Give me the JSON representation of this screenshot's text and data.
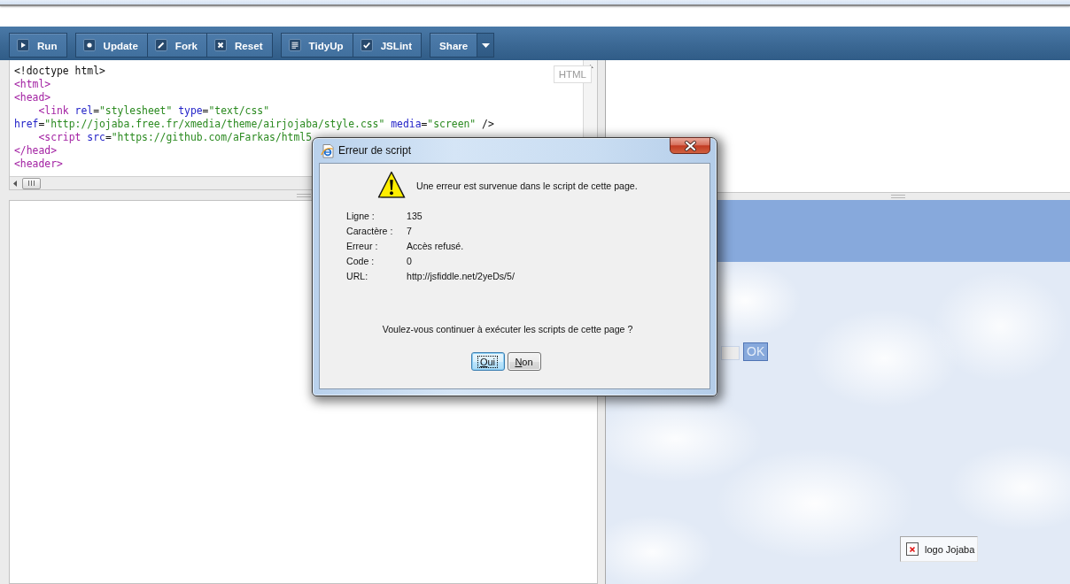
{
  "toolbar": {
    "groups": [
      {
        "buttons": [
          {
            "label": "Run",
            "kind": "action"
          }
        ]
      },
      {
        "buttons": [
          {
            "label": "Update",
            "kind": "action"
          },
          {
            "label": "Fork",
            "kind": "action"
          },
          {
            "label": "Reset",
            "kind": "action"
          }
        ]
      },
      {
        "buttons": [
          {
            "label": "TidyUp",
            "kind": "action"
          },
          {
            "label": "JSLint",
            "kind": "action"
          }
        ]
      },
      {
        "buttons": [
          {
            "label": "Share",
            "kind": "menu"
          }
        ]
      }
    ]
  },
  "html_editor": {
    "mode_label": "HTML",
    "lines": [
      {
        "tokens": [
          {
            "text": "<!doctype html>",
            "kind": "plain"
          }
        ]
      },
      {
        "tokens": [
          {
            "text": "<html>",
            "kind": "tag"
          }
        ]
      },
      {
        "tokens": [
          {
            "text": "<head>",
            "kind": "tag"
          }
        ]
      },
      {
        "tokens": [
          {
            "text": "    <link ",
            "kind": "tag"
          },
          {
            "text": "rel",
            "kind": "attribute"
          },
          {
            "text": "=",
            "kind": "plain"
          },
          {
            "text": "\"stylesheet\" ",
            "kind": "string"
          },
          {
            "text": "type",
            "kind": "attribute"
          },
          {
            "text": "=",
            "kind": "plain"
          },
          {
            "text": "\"text/css\"",
            "kind": "string"
          }
        ]
      },
      {
        "tokens": [
          {
            "text": "href",
            "kind": "attribute"
          },
          {
            "text": "=",
            "kind": "plain"
          },
          {
            "text": "\"http://jojaba.free.fr/xmedia/theme/airjojaba/style.css\" ",
            "kind": "string"
          },
          {
            "text": "media",
            "kind": "attribute"
          },
          {
            "text": "=",
            "kind": "plain"
          },
          {
            "text": "\"screen\"",
            "kind": "string"
          },
          {
            "text": " />",
            "kind": "plain"
          }
        ]
      },
      {
        "tokens": [
          {
            "text": "    <script ",
            "kind": "tag"
          },
          {
            "text": "src",
            "kind": "attribute"
          },
          {
            "text": "=",
            "kind": "plain"
          },
          {
            "text": "\"https://github.com/aFarkas/html5",
            "kind": "string"
          }
        ]
      },
      {
        "tokens": [
          {
            "text": "</head>",
            "kind": "tag"
          }
        ]
      },
      {
        "tokens": [
          {
            "text": "<header>",
            "kind": "tag"
          }
        ]
      }
    ]
  },
  "result": {
    "ok_button": "OK",
    "broken_image_alt": "logo Jojaba"
  },
  "dialog": {
    "title": "Erreur de script",
    "message": "Une erreur est survenue dans le script de cette page.",
    "details": [
      {
        "label": "Ligne :",
        "value": "135"
      },
      {
        "label": "Caractère :",
        "value": "7"
      },
      {
        "label": "Erreur :",
        "value": "Accès refusé."
      },
      {
        "label": "Code :",
        "value": "0"
      },
      {
        "label": "URL:",
        "value": "http://jsfiddle.net/2yeDs/5/"
      }
    ],
    "question": "Voulez-vous continuer à exécuter les scripts de cette page ?",
    "buttons": [
      {
        "label": "Oui",
        "focused": true
      },
      {
        "label": "Non",
        "focused": false
      }
    ]
  }
}
